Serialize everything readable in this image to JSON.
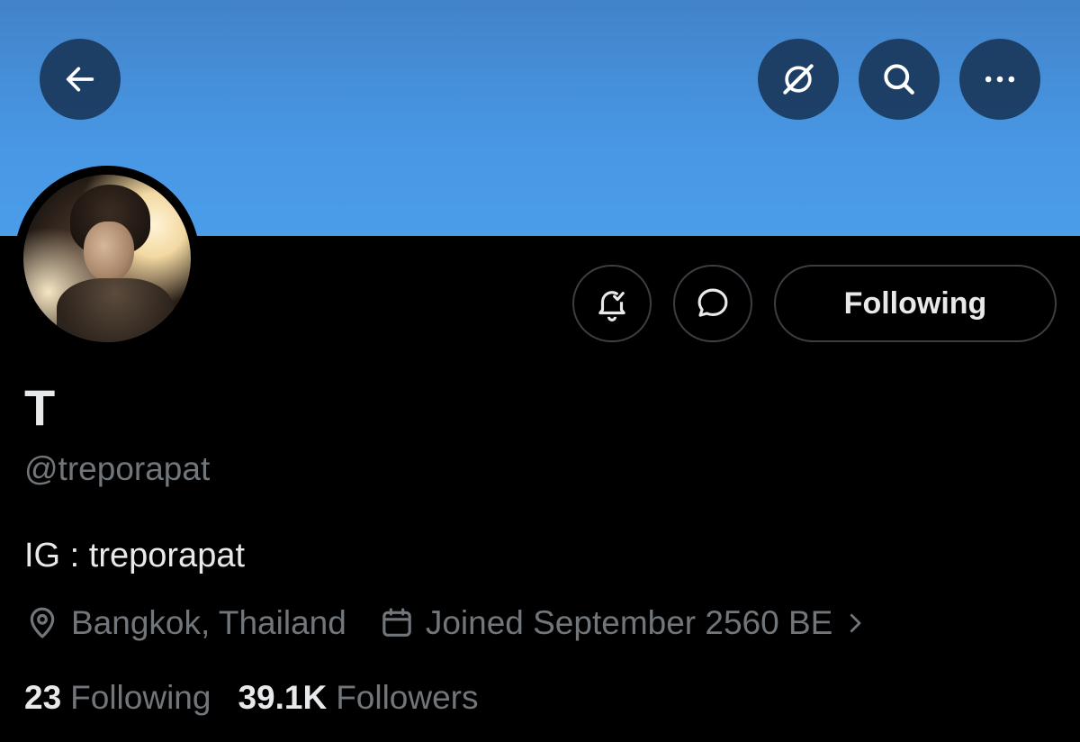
{
  "profile": {
    "display_name": "T",
    "handle": "@treporapat",
    "bio": "IG : treporapat",
    "location": "Bangkok, Thailand",
    "joined": "Joined September 2560 BE",
    "following_count": "23",
    "following_label": "Following",
    "followers_count": "39.1K",
    "followers_label": "Followers"
  },
  "actions": {
    "follow_state_label": "Following"
  },
  "icons": {
    "back": "back-arrow-icon",
    "grok": "grok-icon",
    "search": "search-icon",
    "more": "more-icon",
    "notify": "bell-subscribed-icon",
    "message": "message-icon",
    "location": "location-pin-icon",
    "calendar": "calendar-icon",
    "chevron": "chevron-right-icon"
  },
  "colors": {
    "banner": "#4897e4",
    "text_primary": "#e7e9ea",
    "text_secondary": "#71767b",
    "button_overlay": "#1a385c",
    "border": "#3a3f44"
  }
}
